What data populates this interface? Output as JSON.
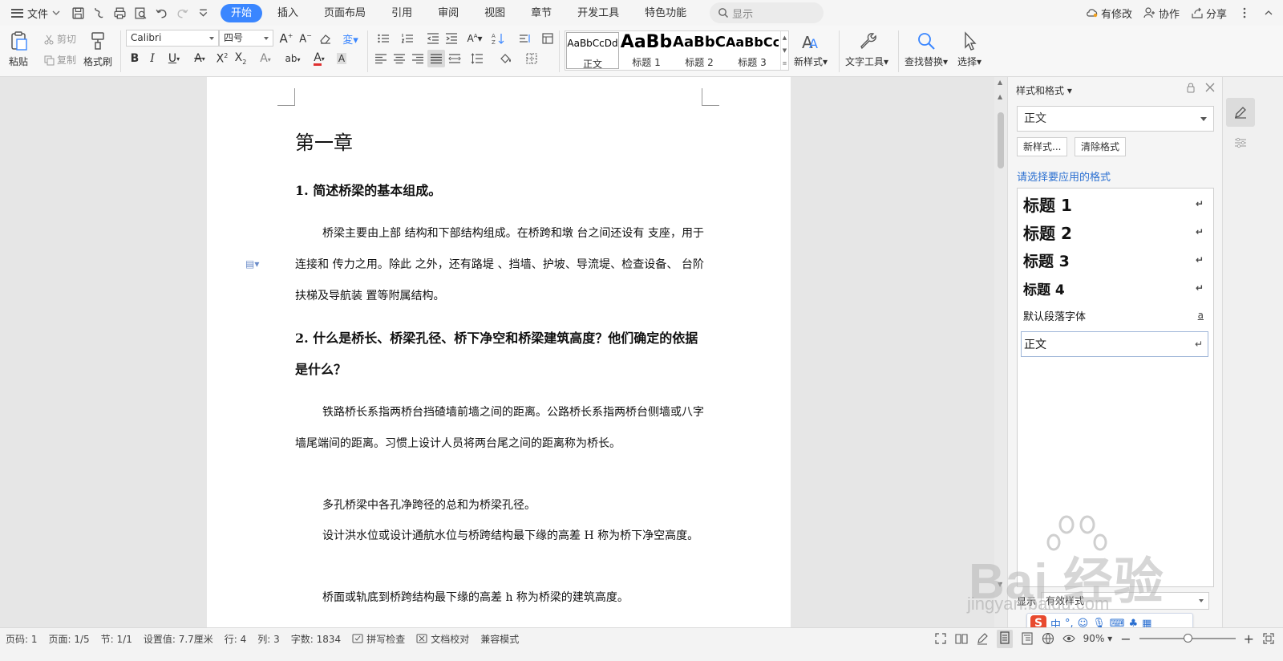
{
  "menubar": {
    "file_label": "文件",
    "tabs": [
      {
        "label": "开始",
        "active": true
      },
      {
        "label": "插入"
      },
      {
        "label": "页面布局"
      },
      {
        "label": "引用"
      },
      {
        "label": "审阅"
      },
      {
        "label": "视图"
      },
      {
        "label": "章节"
      },
      {
        "label": "开发工具"
      },
      {
        "label": "特色功能"
      }
    ],
    "search_placeholder": "显示",
    "modified_label": "有修改",
    "collab_label": "协作",
    "share_label": "分享"
  },
  "ribbon": {
    "paste_label": "粘贴",
    "cut_label": "剪切",
    "copy_label": "复制",
    "format_painter_label": "格式刷",
    "font_name": "Calibri",
    "font_size": "四号",
    "styles": [
      {
        "preview": "AaBbCcDd",
        "name": "正文"
      },
      {
        "preview": "AaBb",
        "name": "标题 1"
      },
      {
        "preview": "AaBbC",
        "name": "标题 2"
      },
      {
        "preview": "AaBbCc",
        "name": "标题 3"
      }
    ],
    "new_style_label": "新样式",
    "text_tools_label": "文字工具",
    "find_replace_label": "查找替换",
    "select_label": "选择"
  },
  "document": {
    "chapter_title": "第一章",
    "q1": "1. 简述桥梁的基本组成。",
    "p1": "桥梁主要由上部  结构和下部结构组成。在桥跨和墩  台之间还设有  支座，用于连接和  传力之用。除此  之外，还有路堤  、挡墙、护坡、导流堤、检查设备、   台阶  扶梯及导航装  置等附属结构。",
    "q2": "2. 什么是桥长、桥梁孔径、桥下净空和桥梁建筑高度？他们确定的依据是什么？",
    "p2": "铁路桥长系指两桥台挡碴墙前墙之间的距离。公路桥长系指两桥台侧墙或八字墙尾端间的距离。习惯上设计人员将两台尾之间的距离称为桥长。",
    "p3": "多孔桥梁中各孔净跨径的总和为桥梁孔径。",
    "p4": "设计洪水位或设计通航水位与桥跨结构最下缘的高差 H 称为桥下净空高度。",
    "p5": "桥面或轨底到桥跨结构最下缘的高差 h 称为桥梁的建筑高度。"
  },
  "pane": {
    "title": "样式和格式",
    "current_style": "正文",
    "new_style_btn": "新样式...",
    "clear_format_btn": "清除格式",
    "hint": "请选择要应用的格式",
    "list": [
      {
        "label": "标题  1",
        "mark": "↵"
      },
      {
        "label": "标题  2",
        "mark": "↵"
      },
      {
        "label": "标题  3",
        "mark": "↵"
      },
      {
        "label": "标题  4",
        "mark": "↵"
      },
      {
        "label": "默认段落字体",
        "mark": "a"
      },
      {
        "label": "正文",
        "mark": "↵"
      }
    ],
    "show_label": "显示",
    "show_value": "有效样式"
  },
  "status": {
    "page": "页码: 1",
    "pages": "页面: 1/5",
    "section": "节: 1/1",
    "setting": "设置值: 7.7厘米",
    "row": "行: 4",
    "col": "列: 3",
    "words": "字数: 1834",
    "spellcheck": "拼写检查",
    "doc_check": "文档校对",
    "compat": "兼容模式",
    "zoom": "90%",
    "zoom_fraction": 0.5
  },
  "ime": {
    "lang": "中"
  },
  "watermark": {
    "brand": "Bai  经验",
    "url": "jingyan.baidu.com"
  },
  "colors": {
    "accent": "#3a86ff",
    "link": "#2a6fd1"
  }
}
